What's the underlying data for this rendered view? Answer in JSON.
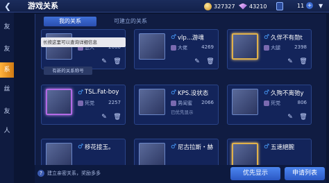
{
  "header": {
    "back_glyph": "❮",
    "title": "游戏关系",
    "gold": "327327",
    "diamonds": "43210",
    "count": "11",
    "plus": "+",
    "dropdown": "▼"
  },
  "side_menu": {
    "items": [
      "友",
      "友",
      "系",
      "丝",
      "友",
      "人"
    ]
  },
  "tabs": {
    "mine": "我的关系",
    "build": "可建立的关系"
  },
  "tooltip": "长按这里可以查询详细信息",
  "badge_tag": "有新的关系称号",
  "cards": [
    {
      "name": "",
      "relation": "恋人",
      "points": "2000",
      "sub": ""
    },
    {
      "name": "vlp...游魂",
      "relation": "大佬",
      "points": "4269",
      "sub": ""
    },
    {
      "name": "久伴不有勋t",
      "relation": "大腿",
      "points": "2398",
      "sub": ""
    },
    {
      "name": "TSL.Fat-boy",
      "relation": "死党",
      "points": "2257",
      "sub": ""
    },
    {
      "name": "KPS.没状态",
      "relation": "男闺蜜",
      "points": "2066",
      "sub": "已优先显示"
    },
    {
      "name": "久殉不离弛y",
      "relation": "死党",
      "points": "806",
      "sub": ""
    },
    {
      "name": "移花接玉。",
      "relation": "",
      "points": "",
      "sub": ""
    },
    {
      "name": "尼古拉斯・赫",
      "relation": "",
      "points": "",
      "sub": ""
    },
    {
      "name": "五速絕腕",
      "relation": "",
      "points": "",
      "sub": ""
    }
  ],
  "icons": {
    "male": "♂",
    "pen": "✎",
    "trash": "🗑"
  },
  "bottom": {
    "hint_icon": "?",
    "hint": "建立亲密关系，奖励多多",
    "priority_btn": "优先显示",
    "requests_btn": "申请列表"
  },
  "colors": {
    "accent_blue": "#3f6fd8",
    "active_menu": "#ffb23d"
  }
}
